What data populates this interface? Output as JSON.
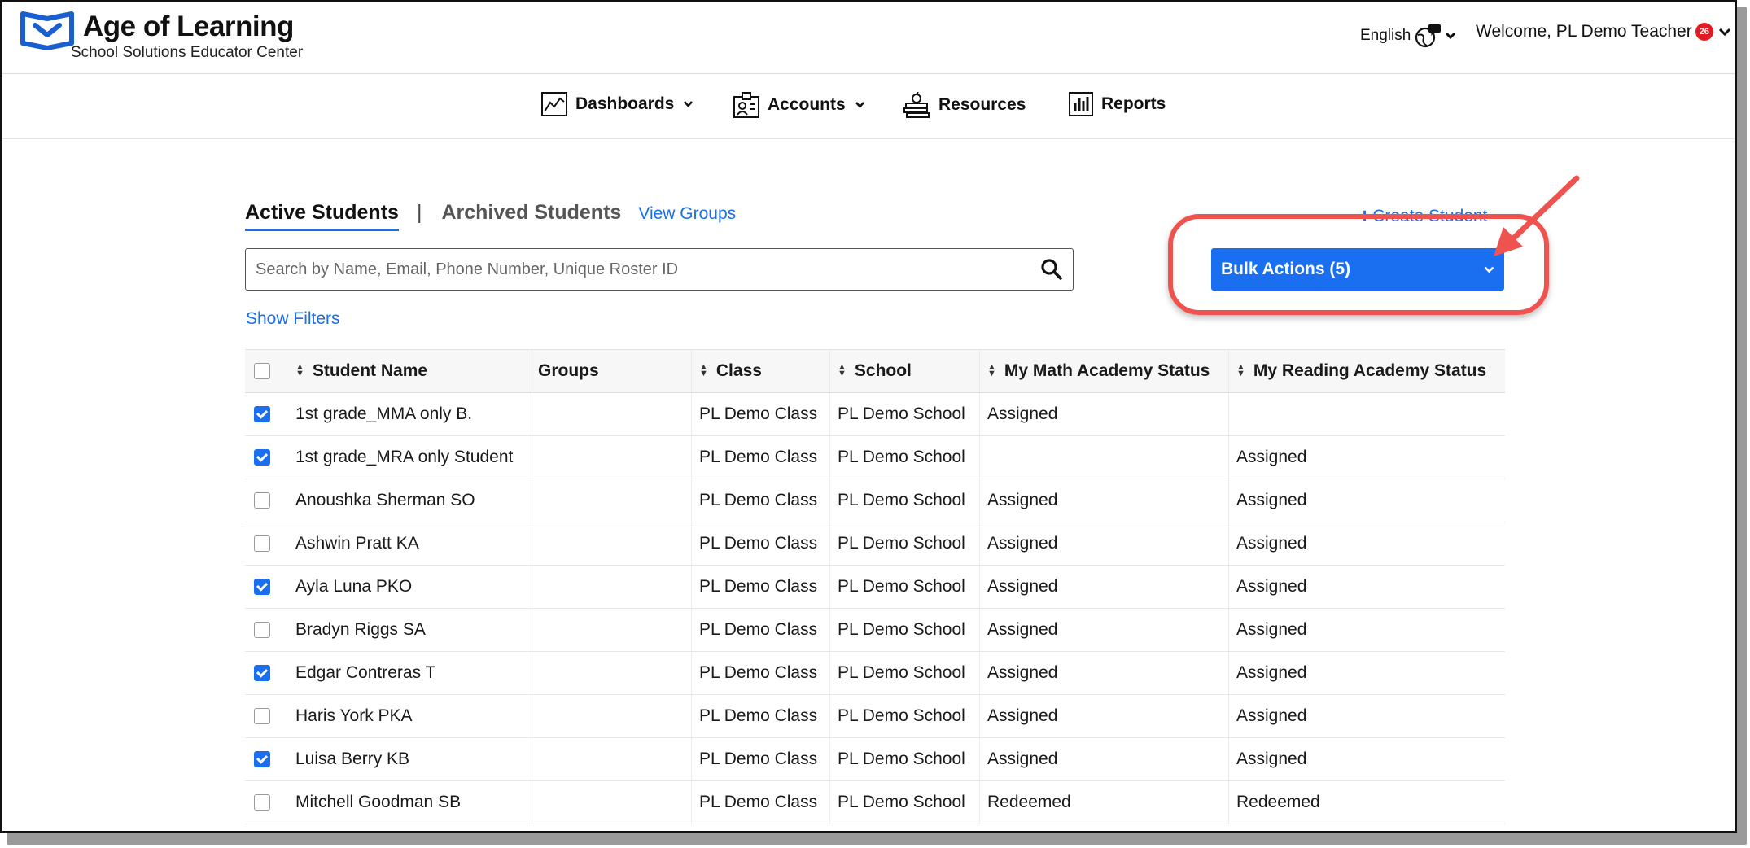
{
  "brand": {
    "title": "Age of Learning",
    "subtitle": "School Solutions Educator Center"
  },
  "header": {
    "language": "English",
    "welcome": "Welcome, PL Demo Teacher",
    "notification_count": "26"
  },
  "nav": {
    "items": [
      {
        "label": "Dashboards",
        "icon": "line-chart-icon",
        "has_dropdown": true
      },
      {
        "label": "Accounts",
        "icon": "id-card-icon",
        "has_dropdown": true
      },
      {
        "label": "Resources",
        "icon": "books-apple-icon",
        "has_dropdown": false
      },
      {
        "label": "Reports",
        "icon": "bar-chart-icon",
        "has_dropdown": false
      }
    ]
  },
  "tabs": {
    "active": "Active Students",
    "separator": "|",
    "archived": "Archived Students",
    "view_groups": "View Groups"
  },
  "create_student": {
    "label": "Create Student"
  },
  "search": {
    "placeholder": "Search by Name, Email, Phone Number, Unique Roster ID"
  },
  "bulk_actions": {
    "label": "Bulk Actions (5)"
  },
  "filters": {
    "label": "Show Filters"
  },
  "table": {
    "headers": {
      "student_name": "Student Name",
      "groups": "Groups",
      "class": "Class",
      "school": "School",
      "math_status": "My Math Academy Status",
      "reading_status": "My Reading Academy Status"
    },
    "rows": [
      {
        "checked": true,
        "name": "1st grade_MMA only B.",
        "groups": "",
        "class": "PL Demo Class",
        "school": "PL Demo School",
        "math": "Assigned",
        "reading": ""
      },
      {
        "checked": true,
        "name": "1st grade_MRA only Student",
        "groups": "",
        "class": "PL Demo Class",
        "school": "PL Demo School",
        "math": "",
        "reading": "Assigned"
      },
      {
        "checked": false,
        "name": "Anoushka Sherman SO",
        "groups": "",
        "class": "PL Demo Class",
        "school": "PL Demo School",
        "math": "Assigned",
        "reading": "Assigned"
      },
      {
        "checked": false,
        "name": "Ashwin Pratt KA",
        "groups": "",
        "class": "PL Demo Class",
        "school": "PL Demo School",
        "math": "Assigned",
        "reading": "Assigned"
      },
      {
        "checked": true,
        "name": "Ayla Luna PKO",
        "groups": "",
        "class": "PL Demo Class",
        "school": "PL Demo School",
        "math": "Assigned",
        "reading": "Assigned"
      },
      {
        "checked": false,
        "name": "Bradyn Riggs SA",
        "groups": "",
        "class": "PL Demo Class",
        "school": "PL Demo School",
        "math": "Assigned",
        "reading": "Assigned"
      },
      {
        "checked": true,
        "name": "Edgar Contreras T",
        "groups": "",
        "class": "PL Demo Class",
        "school": "PL Demo School",
        "math": "Assigned",
        "reading": "Assigned"
      },
      {
        "checked": false,
        "name": "Haris York PKA",
        "groups": "",
        "class": "PL Demo Class",
        "school": "PL Demo School",
        "math": "Assigned",
        "reading": "Assigned"
      },
      {
        "checked": true,
        "name": "Luisa Berry KB",
        "groups": "",
        "class": "PL Demo Class",
        "school": "PL Demo School",
        "math": "Assigned",
        "reading": "Assigned"
      },
      {
        "checked": false,
        "name": "Mitchell Goodman SB",
        "groups": "",
        "class": "PL Demo Class",
        "school": "PL Demo School",
        "math": "Redeemed",
        "reading": "Redeemed"
      }
    ]
  },
  "colors": {
    "accent": "#1a6ff0",
    "link": "#1a6fe8",
    "annotation": "#ef5350",
    "badge": "#e21b23"
  }
}
